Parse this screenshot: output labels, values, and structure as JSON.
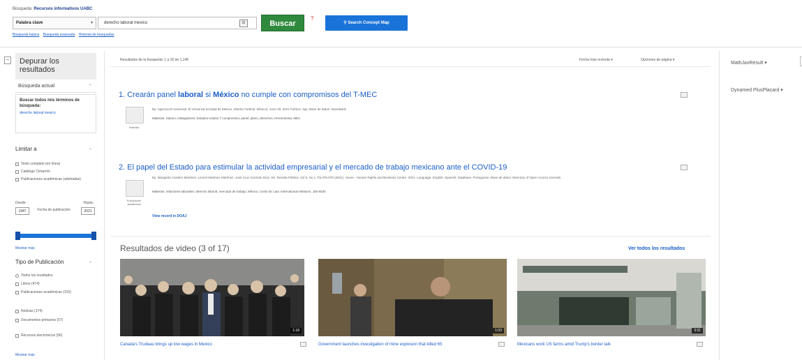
{
  "header": {
    "search_label_prefix": "Búsqueda:",
    "search_label_db": "Recursos informativos UABC",
    "field_select": "Palabra clave",
    "query": "derecho laboral mexico",
    "buscar": "Buscar",
    "concept_map": "Search Concept Map",
    "links": [
      "Búsqueda básica",
      "Búsqueda avanzada",
      "Historial de búsquedas"
    ]
  },
  "sidebar": {
    "refine_title": "Depurar los resultados",
    "current_search": "Búsqueda actual",
    "search_all_terms": "Buscar todos mis términos de búsqueda:",
    "current_query_link": "derecho laboral mexico",
    "limit_to": "Limitar a",
    "limit_options": [
      "Texto completo (en línea)",
      "Catálogo Cimarrón",
      "Publicaciones académicas (arbitradas)"
    ],
    "date_from_label": "Desde:",
    "date_to_label": "Hasta:",
    "date_from": "1947",
    "date_to": "2021",
    "date_caption": "Fecha de publicación",
    "show_more_1": "Mostrar más",
    "pub_type": "Tipo de Publicación",
    "pub_options": [
      "Todos los resultados",
      "Libros (474)",
      "Publicaciones académicas (315)",
      "Noticias (174)",
      "Documentos primarios (57)",
      "Recursos electrónicos (56)"
    ],
    "show_more_2": "Mostrar más"
  },
  "main": {
    "results_count": "Resultados de la búsqueda: 1 a 20 de 1,146",
    "sort": "Fecha más reciente",
    "page_options": "Opciones de página",
    "results": [
      {
        "title_pre": "Crearán panel ",
        "title_b1": "laboral",
        "title_mid": " si ",
        "title_b2": "México",
        "title_post": " no cumple con compromisos del T-MEC",
        "meta": "By: Agencia El Universal. El Universal (Ciudad de México, Distrito Federal, México). June 29, 2021 Política. 2pp. Base de datos: NewsBank",
        "subjects": "Materias: Salario; trabajadores; Estados Unidos T compromiso; panel; plazo; derechos; Herramienta; MEC",
        "thumb_label": "Noticias"
      },
      {
        "title": "El papel del Estado para estimular la actividad empresarial y el mercado de trabajo mexicano ante el COVID-19",
        "meta": "By: Margarita Cardero Martínez; Leonel Martínez Martínez; José Cruz Guzmán Díaz. En: Revista Pública. Vol 5, No 1, Pp 076-076 (2021). Home - Human Rights and Business Centre. 2021. Language: English, Spanish; Database: Portuguese; Base de datos: Directory of Open Access Journals",
        "subjects": "Materias: relaciones laborales; derecho laboral; mercado de trabajo; México; covid-19; Law; International relations; JZ5-6530",
        "link": "View record in DOAJ",
        "thumb_label": "Publicación académica"
      }
    ]
  },
  "videos": {
    "heading": "Resultados de video (3 of 17)",
    "view_all": "Ver todos los resultados",
    "items": [
      {
        "caption": "Canada's Trudeau brings up low wages in Mexico",
        "duration": "1:18"
      },
      {
        "caption": "Government launches investigation of mine explosion that killed 65",
        "duration": "1:03"
      },
      {
        "caption": "Mexicans work US farms amid Trump's border talk",
        "duration": "3:31"
      }
    ]
  },
  "right_sidebar": {
    "items": [
      "MathJaxResult",
      "Dynamed PlusPlacard"
    ]
  }
}
